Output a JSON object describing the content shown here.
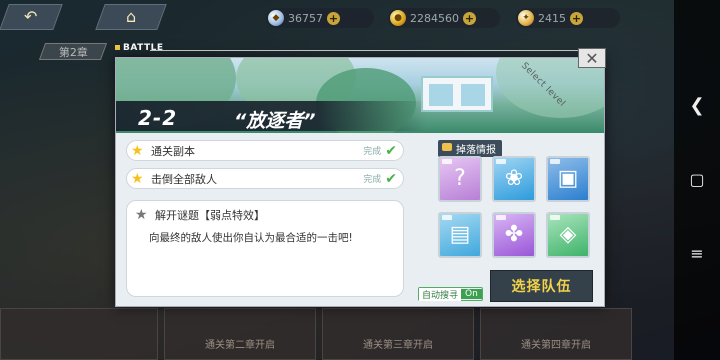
{
  "top_bar": {
    "back_icon": "back-arrow-icon",
    "home_icon": "home-icon",
    "resources": [
      {
        "icon": "crystal-icon",
        "value": "36757"
      },
      {
        "icon": "coin-icon",
        "value": "2284560"
      },
      {
        "icon": "ticket-icon",
        "value": "2415"
      }
    ]
  },
  "background": {
    "chapter_label": "第2章",
    "bottom_strip": [
      "通关第二章开启",
      "通关第三章开启",
      "通关第四章开启"
    ]
  },
  "modal": {
    "battle_label": "BATTLE",
    "close_label": "✕",
    "banner": {
      "select_level": "Select level"
    },
    "stage_number": "2-2",
    "stage_name": "“放逐者”",
    "objectives": [
      {
        "text": "通关副本",
        "status": "完成",
        "done": true
      },
      {
        "text": "击倒全部敌人",
        "status": "完成",
        "done": true
      }
    ],
    "riddle": {
      "title": "解开谜题【弱点特效】",
      "desc": "向最终的敌人使出你自认为最合适的一击吧!"
    },
    "drops": {
      "title": "掉落情报",
      "items": [
        {
          "icon": "unknown-question-icon",
          "color": "#b77fd6"
        },
        {
          "icon": "paw-icon",
          "color": "#2d9bdc"
        },
        {
          "icon": "machine-part-icon",
          "color": "#2b7fd0"
        },
        {
          "icon": "chip-box-icon",
          "color": "#3fa8dc"
        },
        {
          "icon": "crystal-cluster-icon",
          "color": "#9a56d8"
        },
        {
          "icon": "green-card-icon",
          "color": "#3fb36a"
        }
      ]
    },
    "auto_label": "自动搜寻",
    "auto_state": "On",
    "team_button": "选择队伍"
  },
  "nav_bar": {
    "icons": [
      "back-chevron-icon",
      "home-square-icon",
      "menu-icon"
    ]
  }
}
